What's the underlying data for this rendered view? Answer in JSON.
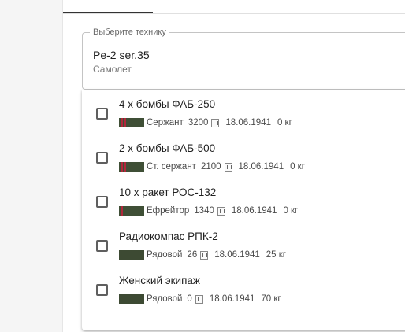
{
  "select": {
    "label": "Выберите технику",
    "value": "Pe-2 ser.35",
    "subtitle": "Самолет"
  },
  "options": [
    {
      "title": "4 х бомбы ФАБ-250",
      "rank": "Сержант",
      "number": "3200",
      "date": "18.06.1941",
      "weight": "0 кг",
      "checked": false,
      "badge": "stripes"
    },
    {
      "title": "2 х бомбы ФАБ-500",
      "rank": "Ст. сержант",
      "number": "2100",
      "date": "18.06.1941",
      "weight": "0 кг",
      "checked": false,
      "badge": "stripes"
    },
    {
      "title": "10 х ракет РОС-132",
      "rank": "Ефрейтор",
      "number": "1340",
      "date": "18.06.1941",
      "weight": "0 кг",
      "checked": false,
      "badge": "stripes"
    },
    {
      "title": "Радиокомпас РПК-2",
      "rank": "Рядовой",
      "number": "26",
      "date": "18.06.1941",
      "weight": "25 кг",
      "checked": false,
      "badge": "plain"
    },
    {
      "title": "Женский экипаж",
      "rank": "Рядовой",
      "number": "0",
      "date": "18.06.1941",
      "weight": "70 кг",
      "checked": false,
      "badge": "plain"
    }
  ],
  "icons": {
    "rank": "rank-insignia-icon",
    "seal": "seal-icon",
    "checkbox": "checkbox-icon"
  },
  "colors": {
    "badge": "#3f4f36",
    "badge_stripe": "#b0273b"
  }
}
